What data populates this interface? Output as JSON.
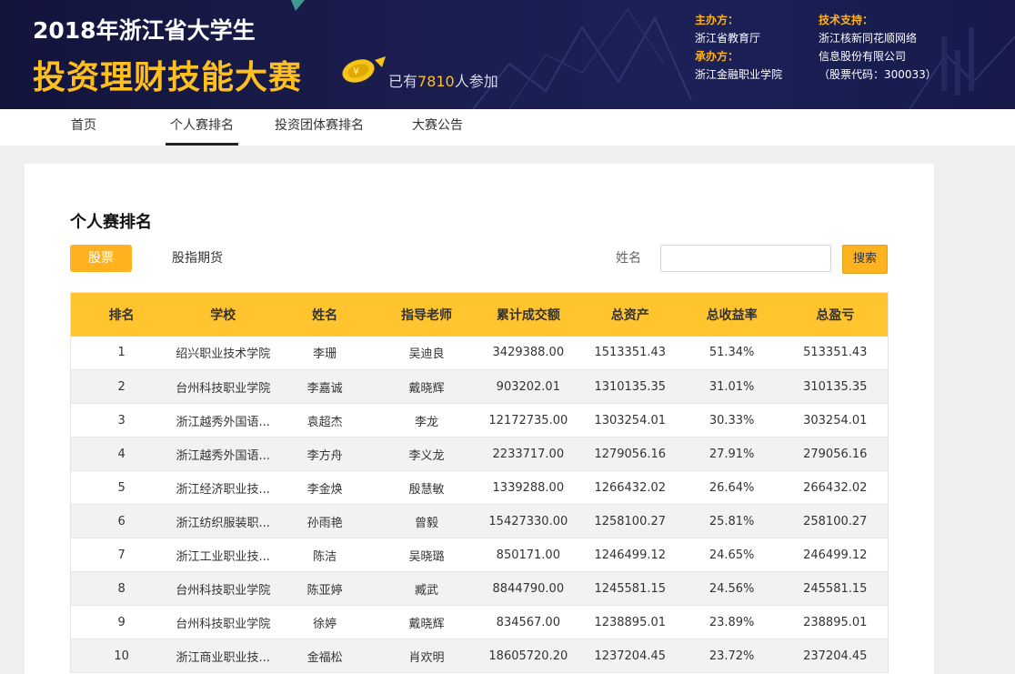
{
  "banner": {
    "title_line1": "2018年浙江省大学生",
    "title_line2": "投资理财技能大赛",
    "participants_prefix": "已有",
    "participants_count": "7810",
    "participants_suffix": "人参加",
    "host_label": "主办方：",
    "host_value": "浙江省教育厅",
    "organizer_label": "承办方：",
    "organizer_value": "浙江金融职业学院",
    "tech_label": "技术支持：",
    "tech_value_line1": "浙江核新同花顺网络",
    "tech_value_line2": "信息股份有限公司",
    "tech_value_line3": "（股票代码：300033）"
  },
  "nav": {
    "items": [
      "首页",
      "个人赛排名",
      "投资团体赛排名",
      "大赛公告"
    ],
    "active": "个人赛排名"
  },
  "ranking": {
    "title": "个人赛排名",
    "tabs": [
      "股票",
      "股指期货"
    ],
    "active_tab": "股票",
    "name_label": "姓名",
    "name_value": "",
    "search_label": "搜索",
    "columns": [
      "排名",
      "学校",
      "姓名",
      "指导老师",
      "累计成交额",
      "总资产",
      "总收益率",
      "总盈亏"
    ],
    "rows": [
      [
        "1",
        "绍兴职业技术学院",
        "李珊",
        "吴迪良",
        "3429388.00",
        "1513351.43",
        "51.34%",
        "513351.43"
      ],
      [
        "2",
        "台州科技职业学院",
        "李嘉诚",
        "戴晓辉",
        "903202.01",
        "1310135.35",
        "31.01%",
        "310135.35"
      ],
      [
        "3",
        "浙江越秀外国语...",
        "袁超杰",
        "李龙",
        "12172735.00",
        "1303254.01",
        "30.33%",
        "303254.01"
      ],
      [
        "4",
        "浙江越秀外国语...",
        "李方舟",
        "李义龙",
        "2233717.00",
        "1279056.16",
        "27.91%",
        "279056.16"
      ],
      [
        "5",
        "浙江经济职业技...",
        "李金焕",
        "殷慧敏",
        "1339288.00",
        "1266432.02",
        "26.64%",
        "266432.02"
      ],
      [
        "6",
        "浙江纺织服装职...",
        "孙雨艳",
        "曾毅",
        "15427330.00",
        "1258100.27",
        "25.81%",
        "258100.27"
      ],
      [
        "7",
        "浙江工业职业技...",
        "陈洁",
        "吴晓璐",
        "850171.00",
        "1246499.12",
        "24.65%",
        "246499.12"
      ],
      [
        "8",
        "台州科技职业学院",
        "陈亚婷",
        "臧武",
        "8844790.00",
        "1245581.15",
        "24.56%",
        "245581.15"
      ],
      [
        "9",
        "台州科技职业学院",
        "徐婷",
        "戴晓辉",
        "834567.00",
        "1238895.01",
        "23.89%",
        "238895.01"
      ],
      [
        "10",
        "浙江商业职业技...",
        "金福松",
        "肖欢明",
        "18605720.20",
        "1237204.45",
        "23.72%",
        "237204.45"
      ]
    ]
  },
  "colors": {
    "accent": "#ffb21f",
    "header_bg": "#ffc42e",
    "banner_bg": "#1a1d4e"
  }
}
